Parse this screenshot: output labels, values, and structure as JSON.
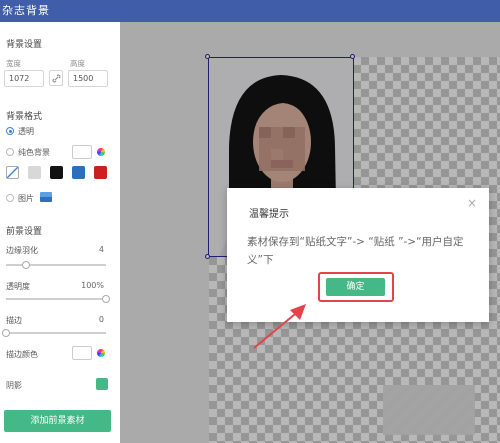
{
  "app": {
    "title": "杂志背景"
  },
  "sidebar": {
    "bg_settings_title": "背景设置",
    "width_label": "宽度",
    "height_label": "高度",
    "width_value": "1072",
    "height_value": "1500",
    "bg_format_title": "背景格式",
    "transparent_label": "透明",
    "solid_label": "纯色背景",
    "image_label": "图片",
    "swatches": [
      "#e8e8e8",
      "#d8d8d8",
      "#111111",
      "#2d6fbd",
      "#cc1f1f"
    ],
    "fg_settings_title": "前景设置",
    "feather_label": "边缘羽化",
    "feather_value": "4",
    "feather_level": 0.2,
    "opacity_label": "透明度",
    "opacity_value": "100%",
    "opacity_level": 1.0,
    "stroke_label": "描边",
    "stroke_value": "0",
    "stroke_level": 0.0,
    "stroke_color_label": "描边颜色",
    "shadow_label": "阴影",
    "add_fg_button": "添加前景素材"
  },
  "dialog": {
    "title": "温馨提示",
    "close": "×",
    "message": "素材保存到“贴纸文字”-> “贴纸 ”->“用户自定义”下",
    "ok_button": "确定"
  },
  "colors": {
    "titlebar": "#3f5da8",
    "accent_green": "#45b887",
    "highlight_red": "#e4434a"
  }
}
